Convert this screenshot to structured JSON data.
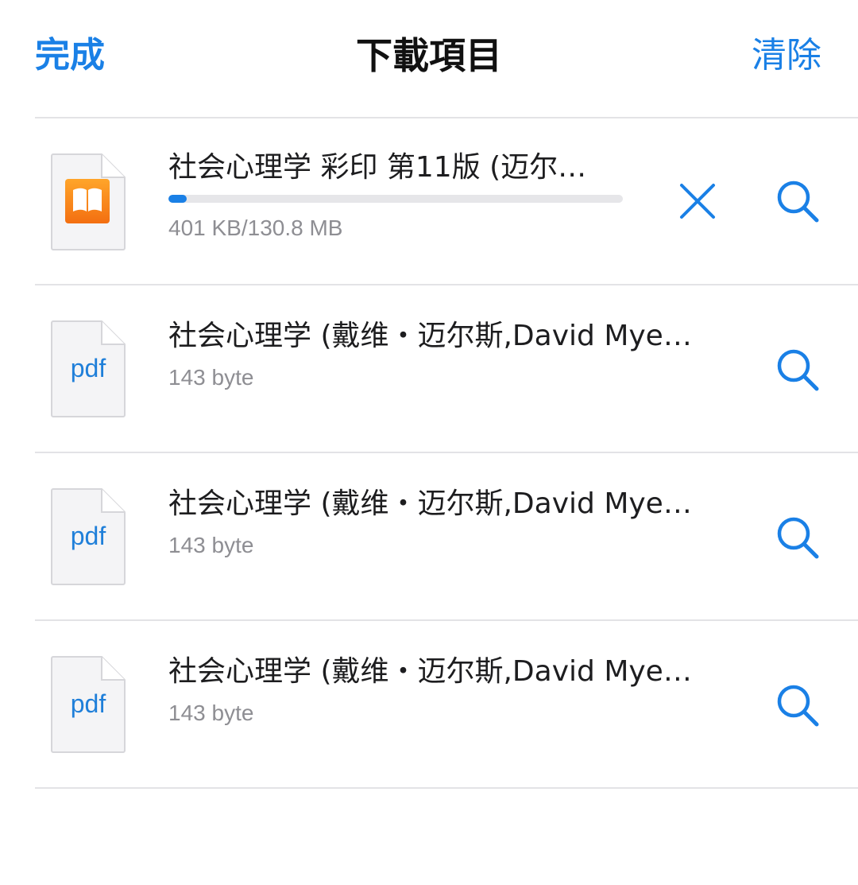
{
  "nav": {
    "done_label": "完成",
    "title": "下載項目",
    "clear_label": "清除"
  },
  "accent_color": "#1a80e6",
  "downloads": [
    {
      "type": "book",
      "icon": "ibooks-icon",
      "title": "社会心理学 彩印 第11版 (迈尔…",
      "size": "401 KB/130.8 MB",
      "progress_percent": 0.3,
      "actions": [
        "cancel-icon",
        "search-icon"
      ]
    },
    {
      "type": "pdf",
      "icon": "pdf-file-icon",
      "icon_label": "pdf",
      "title": "社会心理学 (戴维・迈尔斯,David Mye…",
      "size": "143 byte",
      "actions": [
        "search-icon"
      ]
    },
    {
      "type": "pdf",
      "icon": "pdf-file-icon",
      "icon_label": "pdf",
      "title": "社会心理学 (戴维・迈尔斯,David Mye…",
      "size": "143 byte",
      "actions": [
        "search-icon"
      ]
    },
    {
      "type": "pdf",
      "icon": "pdf-file-icon",
      "icon_label": "pdf",
      "title": "社会心理学 (戴维・迈尔斯,David Mye…",
      "size": "143 byte",
      "actions": [
        "search-icon"
      ]
    }
  ]
}
